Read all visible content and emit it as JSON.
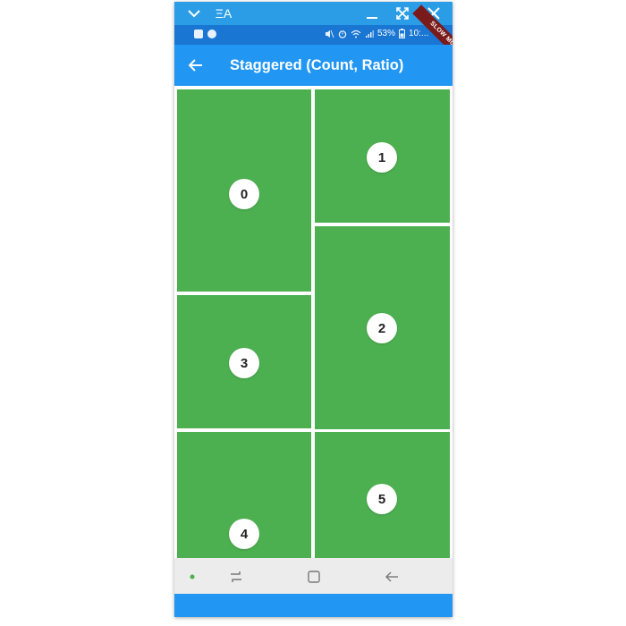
{
  "window": {
    "caption_label": "ΞA",
    "controls": [
      "chevron-down-icon",
      "minimize-icon",
      "fullscreen-icon",
      "close-icon"
    ]
  },
  "status_bar": {
    "battery_text": "53%",
    "time_text": "10:..."
  },
  "debug_banner": "SLOW MODE",
  "app_bar": {
    "title": "Staggered (Count, Ratio)",
    "back_icon": "arrow-back-icon"
  },
  "tiles": [
    {
      "index": "0"
    },
    {
      "index": "1"
    },
    {
      "index": "2"
    },
    {
      "index": "3"
    },
    {
      "index": "4"
    },
    {
      "index": "5"
    }
  ],
  "tile_color": "#4caf50",
  "accent_color": "#2196f3",
  "nav_bar": {
    "buttons": [
      "dot-indicator",
      "recents-icon",
      "home-icon",
      "back-icon"
    ]
  }
}
